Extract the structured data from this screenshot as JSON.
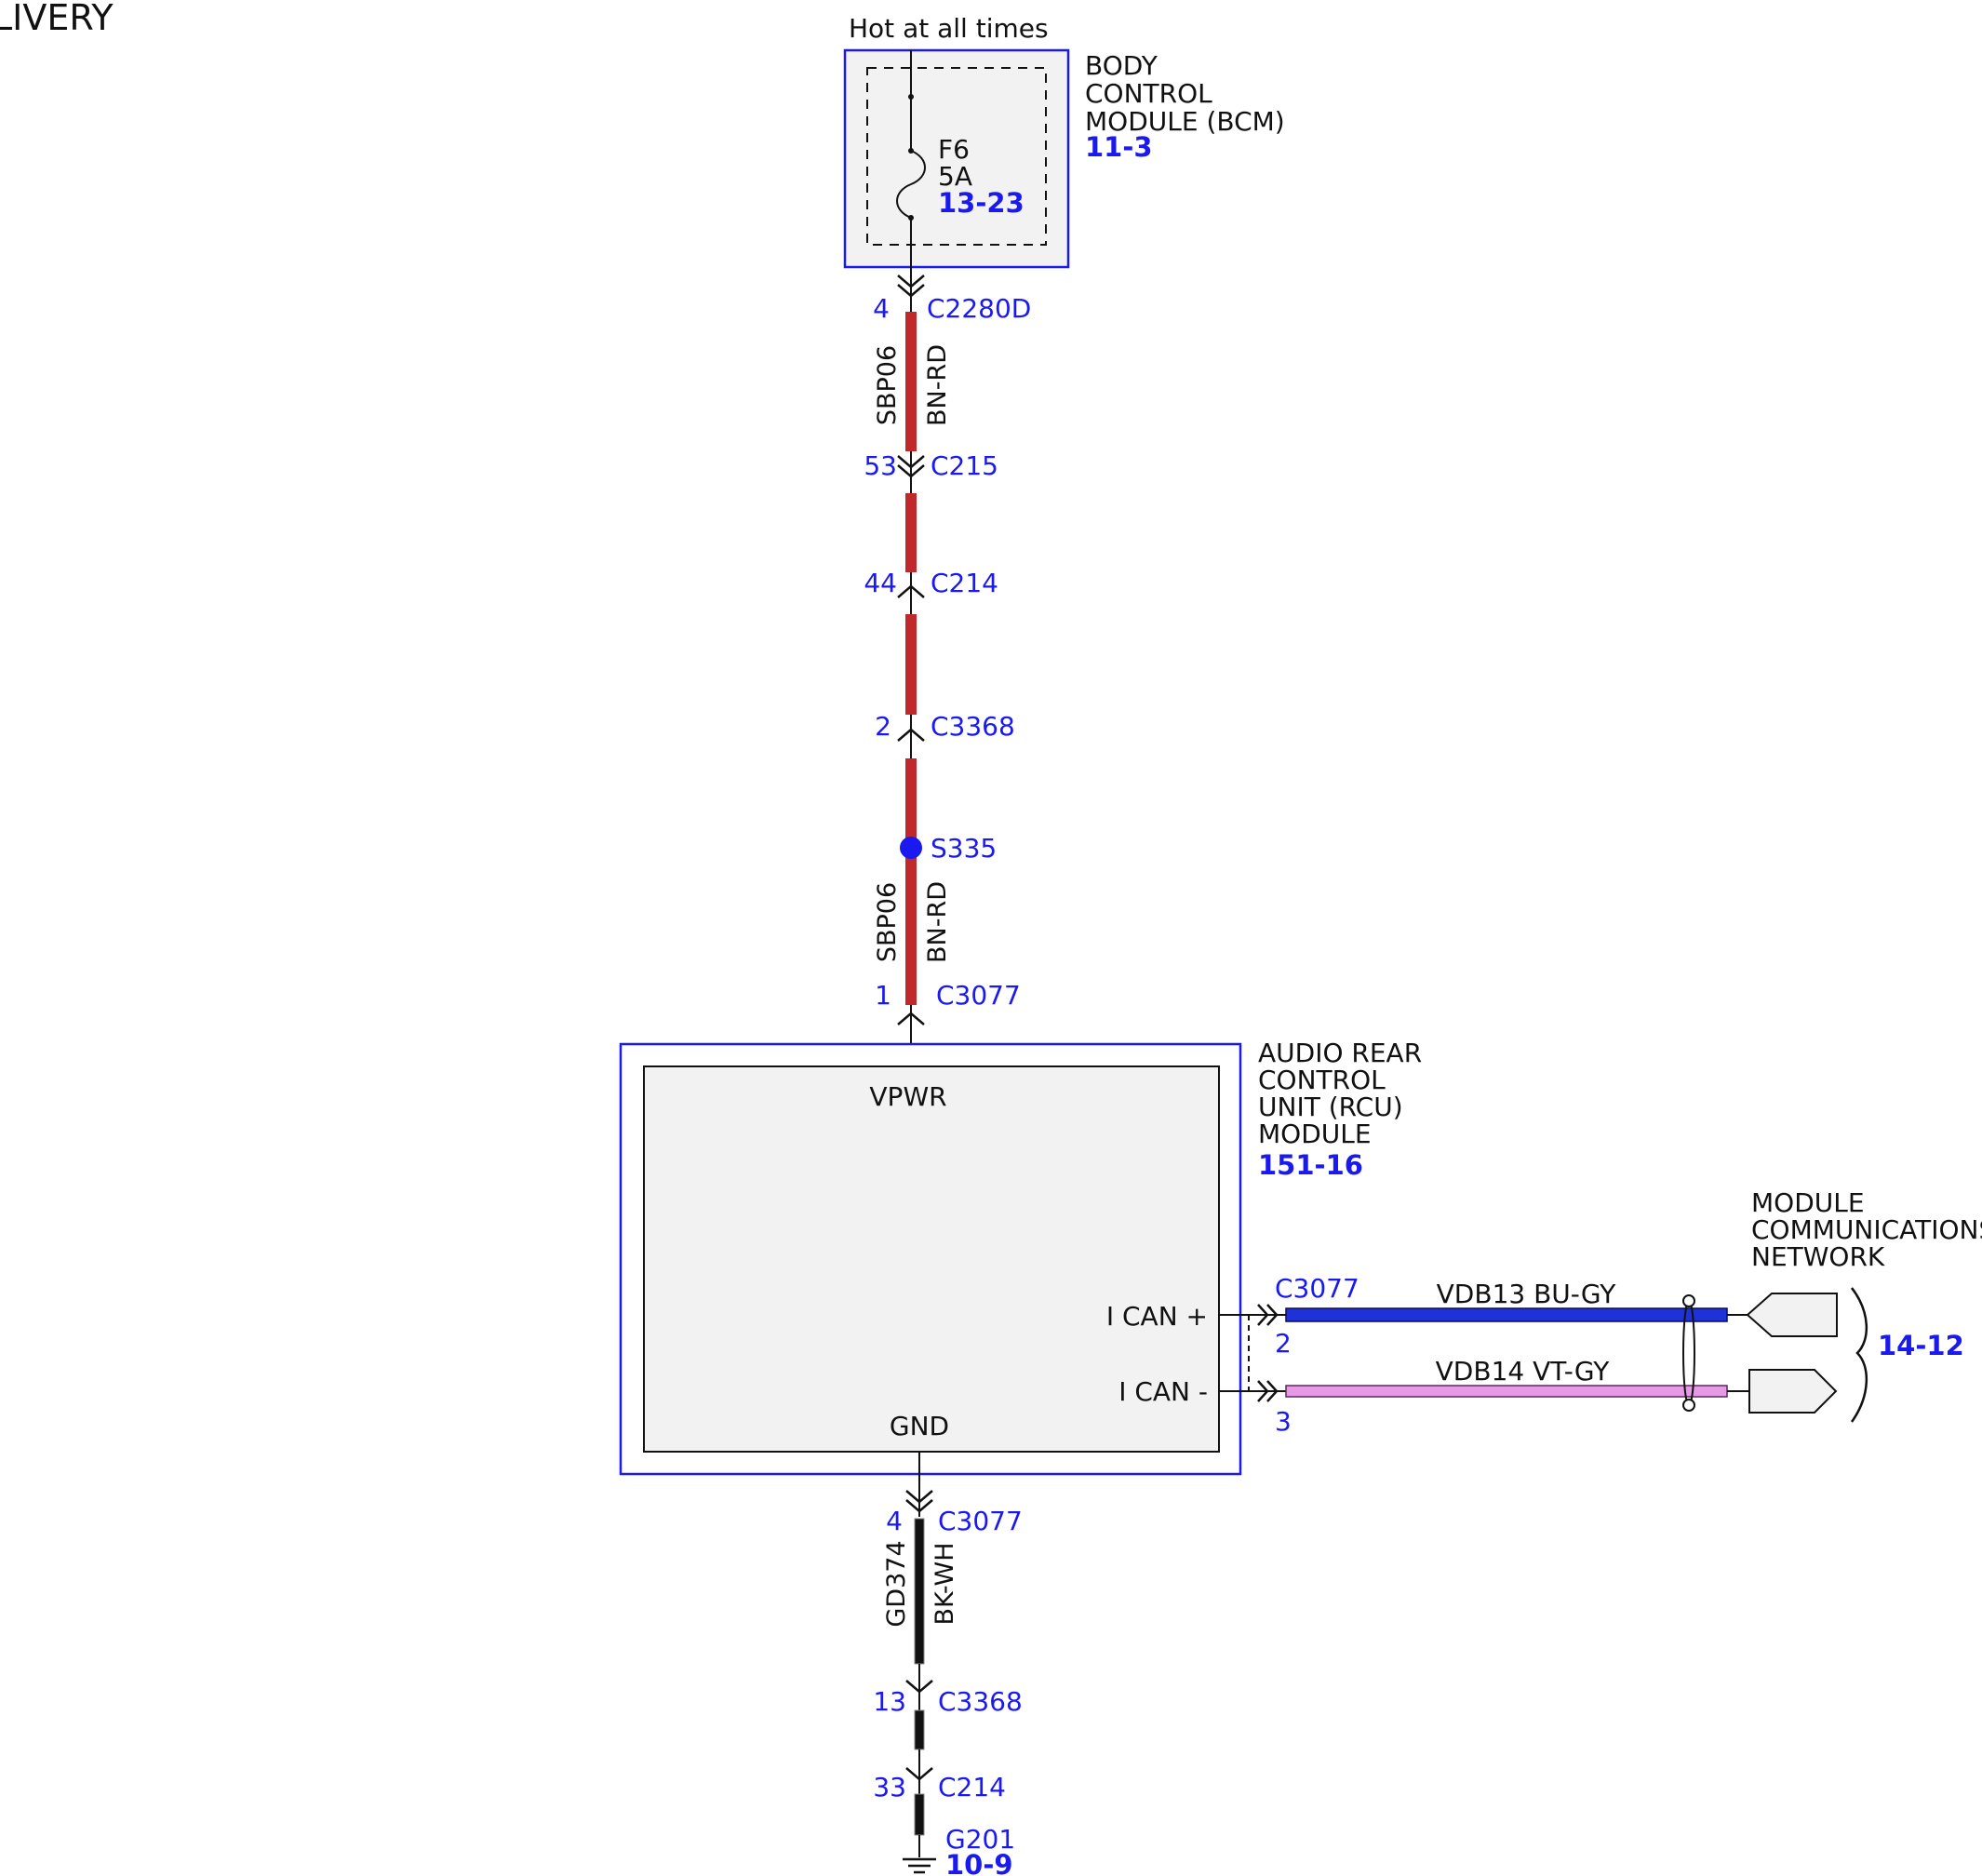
{
  "page": {
    "title_fragment": "LIVERY"
  },
  "power_source": {
    "label": "Hot at all times"
  },
  "bcm": {
    "name_lines": [
      "BODY",
      "CONTROL",
      "MODULE (BCM)"
    ],
    "ref": "11-3",
    "fuse": {
      "name": "F6",
      "rating": "5A",
      "ref": "13-23"
    }
  },
  "power_circuit": {
    "circuit": "SBP06",
    "color": "BN-RD",
    "wire_color_hex": "#c0282c",
    "connectors": [
      {
        "pin": "4",
        "name": "C2280D"
      },
      {
        "pin": "53",
        "name": "C215"
      },
      {
        "pin": "44",
        "name": "C214"
      },
      {
        "pin": "2",
        "name": "C3368"
      },
      {
        "pin": "1",
        "name": "C3077"
      }
    ],
    "splice": "S335"
  },
  "rcu": {
    "name_lines": [
      "AUDIO REAR",
      "CONTROL",
      "UNIT (RCU)",
      "MODULE"
    ],
    "ref": "151-16",
    "pins": {
      "vpwr": "VPWR",
      "gnd": "GND",
      "can_plus": "I CAN +",
      "can_minus": "I CAN -"
    }
  },
  "can_bus": {
    "connector": "C3077",
    "high": {
      "pin": "2",
      "label": "VDB13 BU-GY",
      "wire_color_hex": "#1f32d8"
    },
    "low": {
      "pin": "3",
      "label": "VDB14 VT-GY",
      "wire_color_hex": "#e69ae6"
    }
  },
  "network": {
    "name_lines": [
      "MODULE",
      "COMMUNICATIONS",
      "NETWORK"
    ],
    "ref": "14-12"
  },
  "ground_circuit": {
    "circuit": "GD374",
    "color": "BK-WH",
    "wire_color_hex": "#111111",
    "connectors": [
      {
        "pin": "4",
        "name": "C3077"
      },
      {
        "pin": "13",
        "name": "C3368"
      },
      {
        "pin": "33",
        "name": "C214"
      }
    ],
    "ground": {
      "name": "G201",
      "ref": "10-9"
    }
  },
  "colors": {
    "link_blue": "#1a1af0",
    "module_fill": "#f2f2f2",
    "module_border": "#1a1af0"
  }
}
